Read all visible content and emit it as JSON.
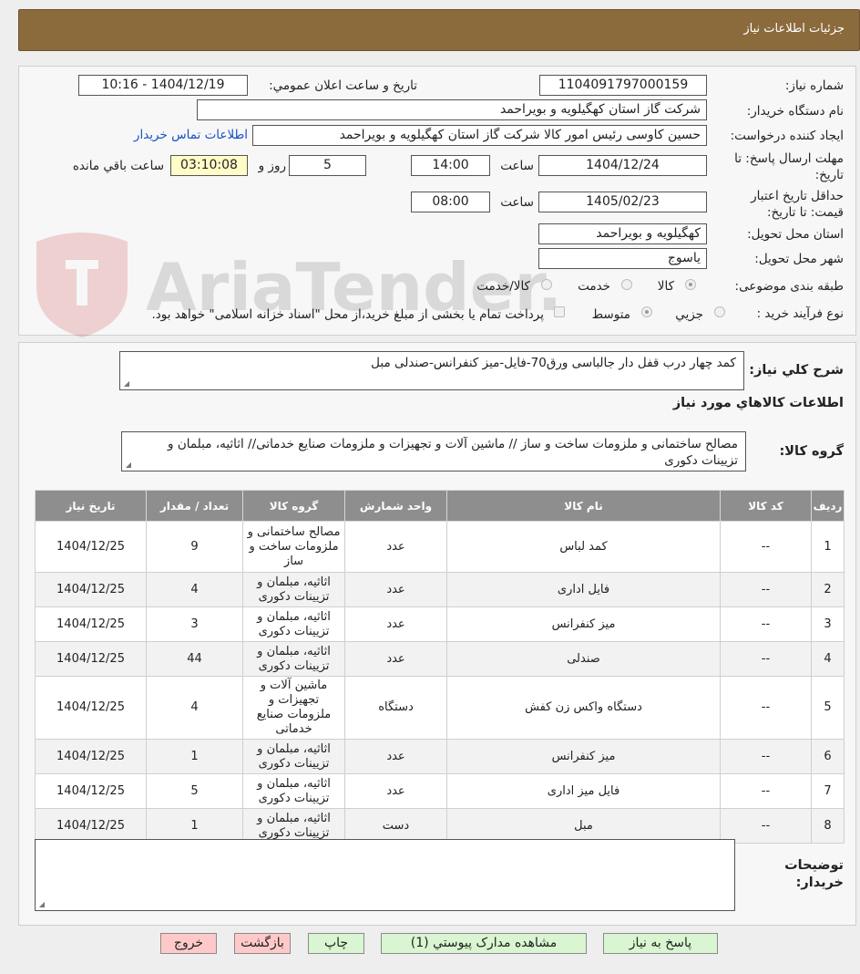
{
  "header": {
    "title": "جزئیات اطلاعات نیاز"
  },
  "watermark": {
    "text": "AriaTender.neT"
  },
  "form": {
    "need_number_label": "شماره نیاز:",
    "need_number": "1104091797000159",
    "announce_label": "تاریخ و ساعت اعلان عمومي:",
    "announce_value": "1404/12/19 - 10:16",
    "buyer_org_label": "نام دستگاه خریدار:",
    "buyer_org": "شرکت گاز استان کهگیلویه و بویراحمد",
    "requester_label": "ایجاد کننده درخواست:",
    "requester": "حسین کاوسی رئیس امور کالا شرکت گاز استان کهگیلویه و بویراحمد",
    "contact_link": "اطلاعات تماس خریدار",
    "deadline_label": "مهلت ارسال پاسخ: تا تاریخ:",
    "deadline_date": "1404/12/24",
    "time_label": "ساعت",
    "deadline_time": "14:00",
    "days": "5",
    "days_label": "روز و",
    "remaining": "03:10:08",
    "remaining_label": "ساعت باقي مانده",
    "validity_label": "حداقل تاریخ اعتبار قیمت: تا تاریخ:",
    "validity_date": "1405/02/23",
    "validity_time": "08:00",
    "province_label": "استان محل تحویل:",
    "province": "کهگیلویه و بویراحمد",
    "city_label": "شهر محل تحویل:",
    "city": "یاسوج",
    "category_label": "طبقه بندی موضوعی:",
    "category_options": [
      "کالا",
      "خدمت",
      "کالا/خدمت"
    ],
    "category_selected": "کالا",
    "process_label": "نوع فرآیند خرید :",
    "process_options": [
      "جزیي",
      "متوسط"
    ],
    "process_selected": "متوسط",
    "payment_note": "پرداخت تمام یا بخشی از مبلغ خرید،از محل \"اسناد خزانه اسلامی\" خواهد بود."
  },
  "summary": {
    "label": "شرح کلي نیاز:",
    "value": "کمد چهار درب قفل دار جالباسی ورق70-فایل-میز کنفرانس-صندلی مبل"
  },
  "goods_section": {
    "title": "اطلاعات کالاهاي مورد نیاز",
    "group_label": "گروه کالا:",
    "group_value": "مصالح ساختمانی و ملزومات ساخت و ساز // ماشین آلات و تجهیزات و ملزومات صنایع خدماتی// اثاثیه، مبلمان و تزیینات دکوری"
  },
  "table": {
    "headers": [
      "ردیف",
      "کد کالا",
      "نام کالا",
      "واحد شمارش",
      "گروه کالا",
      "تعداد / مقدار",
      "تاریخ نیاز"
    ],
    "rows": [
      [
        "1",
        "--",
        "کمد لباس",
        "عدد",
        "مصالح ساختمانی و ملزومات ساخت و ساز",
        "9",
        "1404/12/25"
      ],
      [
        "2",
        "--",
        "فایل اداری",
        "عدد",
        "اثاثیه، مبلمان و تزیینات دکوری",
        "4",
        "1404/12/25"
      ],
      [
        "3",
        "--",
        "میز کنفرانس",
        "عدد",
        "اثاثیه، مبلمان و تزیینات دکوری",
        "3",
        "1404/12/25"
      ],
      [
        "4",
        "--",
        "صندلی",
        "عدد",
        "اثاثیه، مبلمان و تزیینات دکوری",
        "44",
        "1404/12/25"
      ],
      [
        "5",
        "--",
        "دستگاه واکس زن کفش",
        "دستگاه",
        "ماشین آلات و تجهیزات و ملزومات صنایع خدماتی",
        "4",
        "1404/12/25"
      ],
      [
        "6",
        "--",
        "میز کنفرانس",
        "عدد",
        "اثاثیه، مبلمان و تزیینات دکوری",
        "1",
        "1404/12/25"
      ],
      [
        "7",
        "--",
        "فایل میز اداری",
        "عدد",
        "اثاثیه، مبلمان و تزیینات دکوری",
        "5",
        "1404/12/25"
      ],
      [
        "8",
        "--",
        "مبل",
        "دست",
        "اثاثیه، مبلمان و تزیینات دکوری",
        "1",
        "1404/12/25"
      ]
    ]
  },
  "notes": {
    "label": "توضیحات خریدار:",
    "value": ""
  },
  "buttons": {
    "reply": "پاسخ به نیاز",
    "attachments": "مشاهده مدارک پیوستي (1)",
    "print": "چاپ",
    "back": "بازگشت",
    "exit": "خروج"
  }
}
